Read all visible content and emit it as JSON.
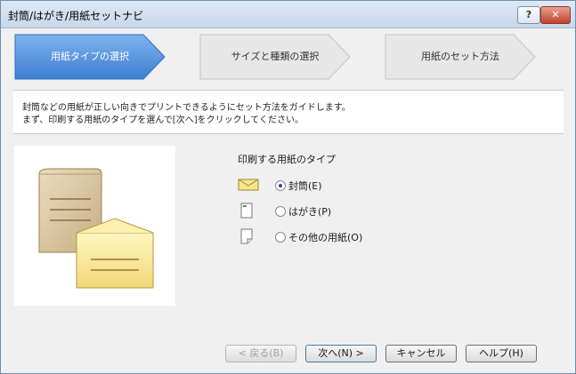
{
  "window": {
    "title": "封筒/はがき/用紙セットナビ"
  },
  "titlebar": {
    "help": "?",
    "close": "✕"
  },
  "steps": [
    {
      "label": "用紙タイプの選択",
      "active": true
    },
    {
      "label": "サイズと種類の選択",
      "active": false
    },
    {
      "label": "用紙のセット方法",
      "active": false
    }
  ],
  "description": {
    "line1": "封筒などの用紙が正しい向きでプリントできるようにセット方法をガイドします。",
    "line2": "まず、印刷する用紙のタイプを選んで[次へ]をクリックしてください。"
  },
  "paper_type": {
    "label": "印刷する用紙のタイプ",
    "options": [
      {
        "label": "封筒(E)",
        "selected": true,
        "icon": "envelope-icon"
      },
      {
        "label": "はがき(P)",
        "selected": false,
        "icon": "postcard-icon"
      },
      {
        "label": "その他の用紙(O)",
        "selected": false,
        "icon": "paper-icon"
      }
    ]
  },
  "buttons": {
    "back": "< 戻る(B)",
    "next": "次へ(N) >",
    "cancel": "キャンセル",
    "help": "ヘルプ(H)"
  },
  "colors": {
    "active_step": "#4f8fd9",
    "inactive_step": "#e6e6e6"
  }
}
